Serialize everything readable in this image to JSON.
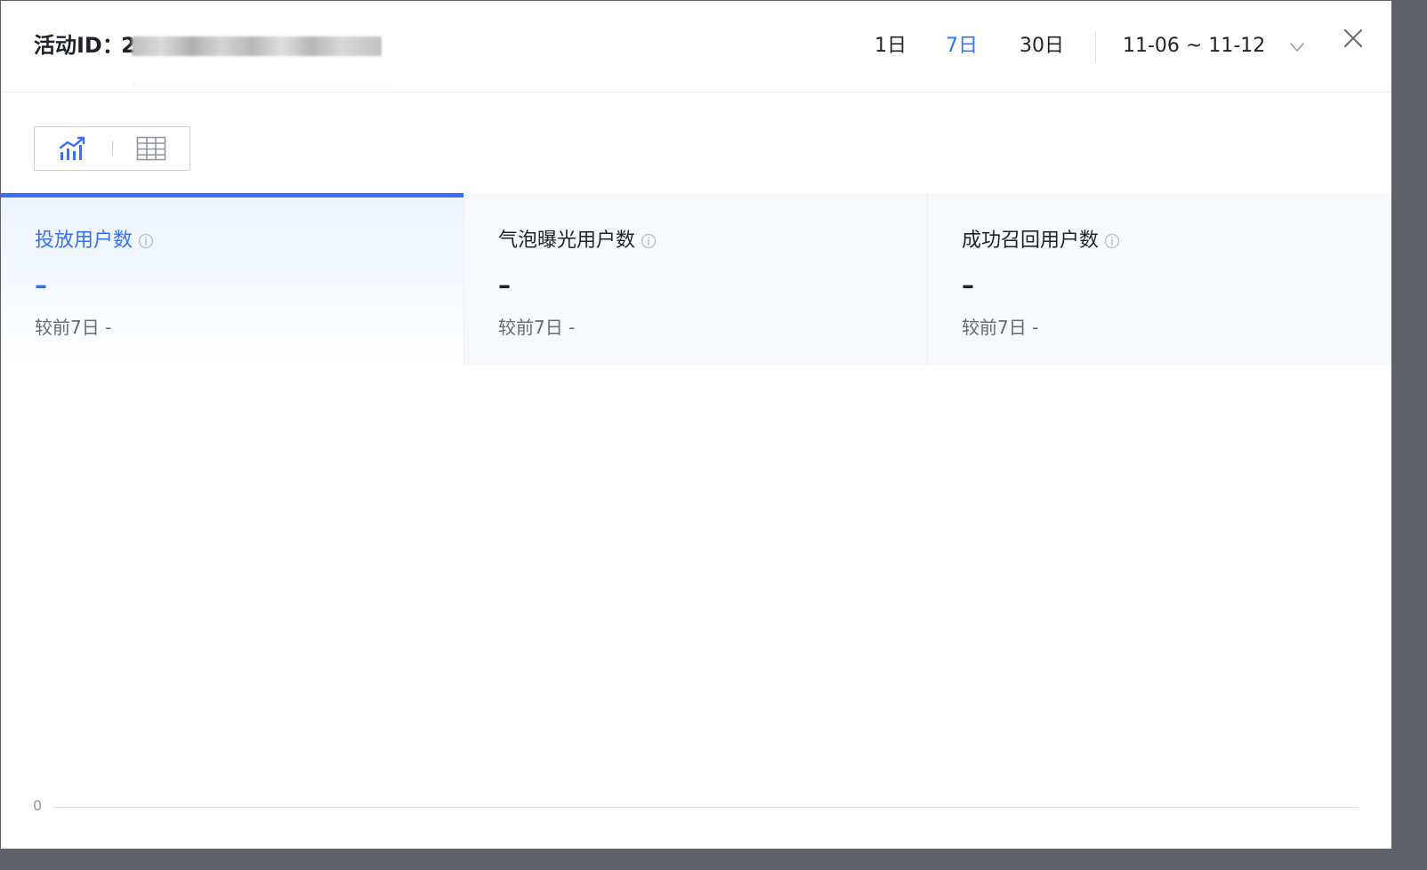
{
  "header": {
    "title_label": "活动ID：",
    "title_value": "2",
    "range_tabs": [
      "1日",
      "7日",
      "30日"
    ],
    "active_range_index": 1,
    "date_range": "11-06 ~ 11-12"
  },
  "view_toggle": {
    "active": "chart"
  },
  "metrics": [
    {
      "title": "投放用户数",
      "value": "–",
      "compare": "较前7日 -"
    },
    {
      "title": "气泡曝光用户数",
      "value": "–",
      "compare": "较前7日 -"
    },
    {
      "title": "成功召回用户数",
      "value": "–",
      "compare": "较前7日 -"
    }
  ],
  "chart": {
    "axis_zero": "0"
  },
  "colors": {
    "accent": "#3370ff",
    "text_primary": "#1f2329",
    "text_secondary": "#646a73",
    "border": "#dee0e3"
  },
  "icons": {
    "chart_toggle": "line-chart-icon",
    "table_toggle": "table-icon",
    "info": "info-icon",
    "dropdown": "chevron-down-icon",
    "close": "close-icon"
  }
}
